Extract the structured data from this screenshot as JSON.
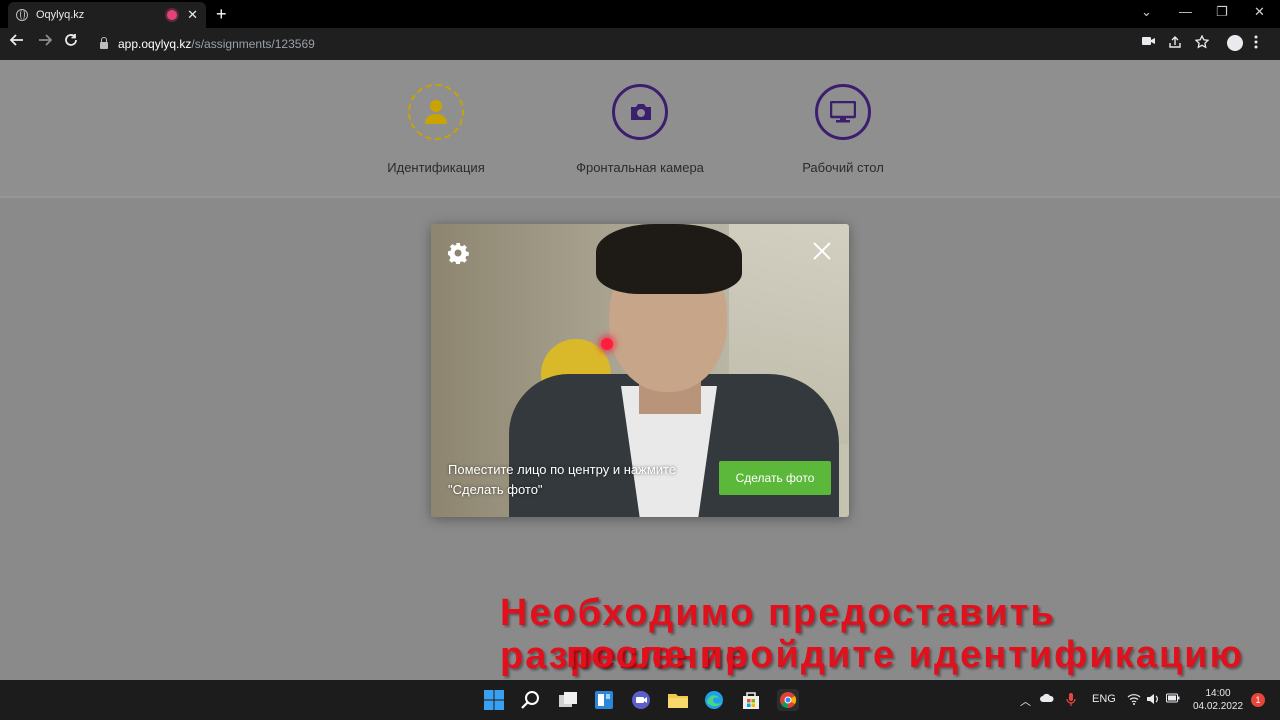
{
  "browser": {
    "tab_title": "Oqylyq.kz",
    "tab_close": "✕",
    "new_tab": "+",
    "url_host": "app.oqylyq.kz",
    "url_path": "/s/assignments/123569",
    "window_minimize": "—",
    "window_restore": "❐",
    "window_close": "✕",
    "tab_search": "⌄"
  },
  "steps": [
    {
      "label": "Идентификация",
      "icon": "user-icon",
      "state": "active"
    },
    {
      "label": "Фронтальная камера",
      "icon": "camera-icon",
      "state": "pending"
    },
    {
      "label": "Рабочий стол",
      "icon": "monitor-icon",
      "state": "pending"
    }
  ],
  "modal": {
    "instruction": "Поместите лицо по центру и нажмите \"Сделать фото\"",
    "button_label": "Сделать фото"
  },
  "overlay_caption": {
    "line1": "Необходимо предоставить разрешение",
    "line2": "после пройдите идентификацию"
  },
  "taskbar": {
    "lang": "ENG",
    "time": "14:00",
    "date": "04.02.2022",
    "notifications": "1"
  },
  "colors": {
    "accent_purple": "#3b1f6e",
    "accent_yellow": "#c9a400",
    "button_green": "#5cb83a",
    "caption_red": "#e0101c"
  }
}
